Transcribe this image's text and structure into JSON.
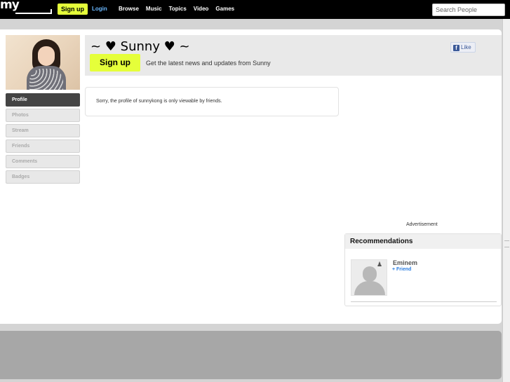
{
  "topbar": {
    "logo": "my",
    "signup_label": "Sign up",
    "login_label": "Login",
    "nav": [
      "Browse",
      "Music",
      "Topics",
      "Video",
      "Games"
    ],
    "search_placeholder": "Search People"
  },
  "profile": {
    "name": "~ ♥ Sunny ♥ ~",
    "signup_label": "Sign up",
    "tagline": "Get the latest news and updates from Sunny",
    "like_label": "Like",
    "notice": "Sorry, the profile of sunnykong is only viewable by friends."
  },
  "sidebar": {
    "items": [
      {
        "label": "Profile",
        "active": true
      },
      {
        "label": "Photos",
        "active": false
      },
      {
        "label": "Stream",
        "active": false
      },
      {
        "label": "Friends",
        "active": false
      },
      {
        "label": "Comments",
        "active": false
      },
      {
        "label": "Badges",
        "active": false
      }
    ]
  },
  "advertisement_label": "Advertisement",
  "recommendations": {
    "title": "Recommendations",
    "items": [
      {
        "name": "Eminem",
        "action": "+ Friend"
      }
    ]
  },
  "colors": {
    "accent": "#e5ff3a",
    "link": "#2a7de1",
    "facebook": "#3b5998"
  }
}
